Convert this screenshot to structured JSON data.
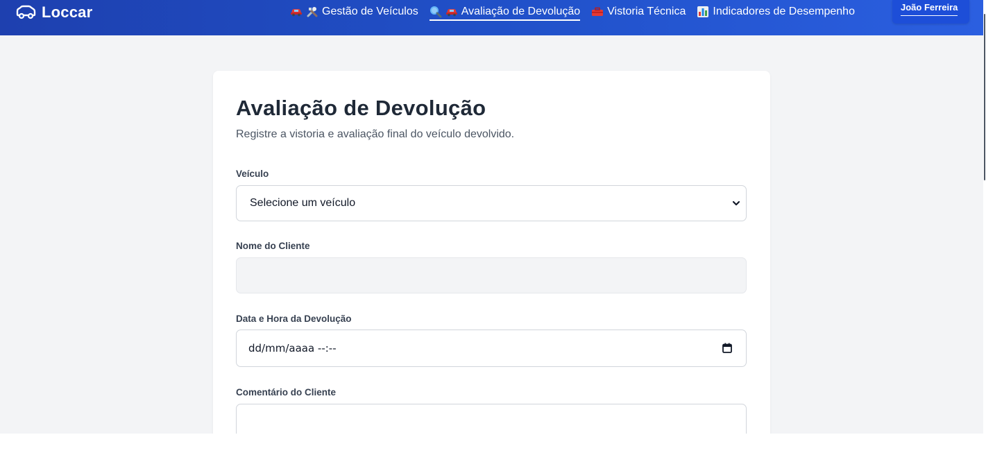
{
  "navbar": {
    "brand": "Loccar",
    "links": [
      {
        "label": "Gestão de Veículos",
        "icons": [
          "car-icon",
          "tools-icon"
        ],
        "active": false
      },
      {
        "label": "Avaliação de Devolução",
        "icons": [
          "magnifier-icon",
          "car-icon"
        ],
        "active": true
      },
      {
        "label": "Vistoria Técnica",
        "icons": [
          "toolbox-icon"
        ],
        "active": false
      },
      {
        "label": "Indicadores de Desempenho",
        "icons": [
          "bar-chart-icon"
        ],
        "active": false
      }
    ],
    "user": "João Ferreira"
  },
  "form": {
    "title": "Avaliação de Devolução",
    "subtitle": "Registre a vistoria e avaliação final do veículo devolvido.",
    "vehicle": {
      "label": "Veículo",
      "value": "Selecione um veículo"
    },
    "client_name": {
      "label": "Nome do Cliente",
      "value": ""
    },
    "return_datetime": {
      "label": "Data e Hora da Devolução",
      "value": "dd/mm/aaaa --:--"
    },
    "client_comment": {
      "label": "Comentário do Cliente",
      "value": ""
    }
  },
  "colors": {
    "nav_start": "#1e40af",
    "nav_end": "#2b5fe0",
    "background": "#f3f4f6",
    "card": "#ffffff",
    "title": "#1f2937"
  }
}
